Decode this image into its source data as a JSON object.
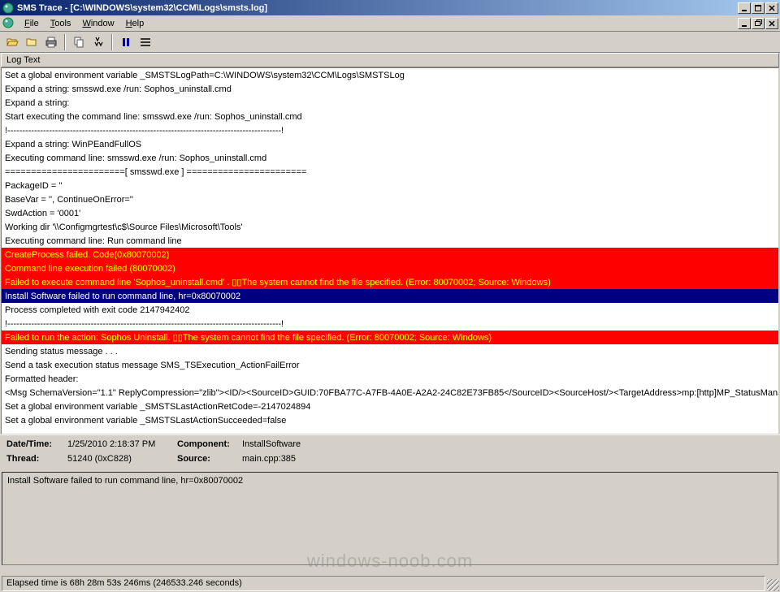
{
  "title": "SMS Trace - [C:\\WINDOWS\\system32\\CCM\\Logs\\smsts.log]",
  "menus": {
    "file": "File",
    "tools": "Tools",
    "window": "Window",
    "help": "Help"
  },
  "column_header": "Log Text",
  "log_lines": [
    {
      "t": "Set a global environment variable _SMSTSLogPath=C:\\WINDOWS\\system32\\CCM\\Logs\\SMSTSLog",
      "s": "n"
    },
    {
      "t": "Expand a string: smsswd.exe /run: Sophos_uninstall.cmd",
      "s": "n"
    },
    {
      "t": "Expand a string:",
      "s": "n"
    },
    {
      "t": "Start executing the command line: smsswd.exe /run: Sophos_uninstall.cmd",
      "s": "n"
    },
    {
      "t": "!--------------------------------------------------------------------------------------------!",
      "s": "n"
    },
    {
      "t": "Expand a string: WinPEandFullOS",
      "s": "n"
    },
    {
      "t": "Executing command line: smsswd.exe /run: Sophos_uninstall.cmd",
      "s": "n"
    },
    {
      "t": "=======================[ smsswd.exe ] =======================",
      "s": "n"
    },
    {
      "t": "PackageID = ''",
      "s": "n"
    },
    {
      "t": "BaseVar = '', ContinueOnError=''",
      "s": "n"
    },
    {
      "t": "SwdAction = '0001'",
      "s": "n"
    },
    {
      "t": "Working dir '\\\\Configmgrtest\\c$\\Source Files\\Microsoft\\Tools'",
      "s": "n"
    },
    {
      "t": "Executing command line: Run command line",
      "s": "n"
    },
    {
      "t": "CreateProcess failed. Code(0x80070002)",
      "s": "e"
    },
    {
      "t": "Command line execution failed (80070002)",
      "s": "e"
    },
    {
      "t": "Failed to execute command line 'Sophos_uninstall.cmd' . ▯▯The system cannot find the file specified. (Error: 80070002; Source: Windows)",
      "s": "e"
    },
    {
      "t": "Install Software failed to run command line, hr=0x80070002",
      "s": "s"
    },
    {
      "t": "Process completed with exit code 2147942402",
      "s": "n"
    },
    {
      "t": "!--------------------------------------------------------------------------------------------!",
      "s": "n"
    },
    {
      "t": "Failed to run the action: Sophos Uninstall. ▯▯The system cannot find the file specified. (Error: 80070002; Source: Windows)",
      "s": "e"
    },
    {
      "t": "Sending status message . . .",
      "s": "n"
    },
    {
      "t": "Send a task execution status message SMS_TSExecution_ActionFailError",
      "s": "n"
    },
    {
      "t": "Formatted header:",
      "s": "n"
    },
    {
      "t": "<Msg SchemaVersion=\"1.1\" ReplyCompression=\"zlib\"><ID/><SourceID>GUID:70FBA77C-A7FB-4A0E-A2A2-24C82E73FB85</SourceID><SourceHost/><TargetAddress>mp:[http]MP_StatusMana",
      "s": "n"
    },
    {
      "t": "Set a global environment variable _SMSTSLastActionRetCode=-2147024894",
      "s": "n"
    },
    {
      "t": "Set a global environment variable _SMSTSLastActionSucceeded=false",
      "s": "n"
    }
  ],
  "details": {
    "datetime_label": "Date/Time:",
    "datetime_value": "1/25/2010 2:18:37 PM",
    "component_label": "Component:",
    "component_value": "InstallSoftware",
    "thread_label": "Thread:",
    "thread_value": "51240 (0xC828)",
    "source_label": "Source:",
    "source_value": "main.cpp:385"
  },
  "message_text": "Install Software failed to run command line, hr=0x80070002",
  "statusbar": "Elapsed time is 68h 28m 53s 246ms (246533.246 seconds)",
  "watermark": "windows-noob.com"
}
